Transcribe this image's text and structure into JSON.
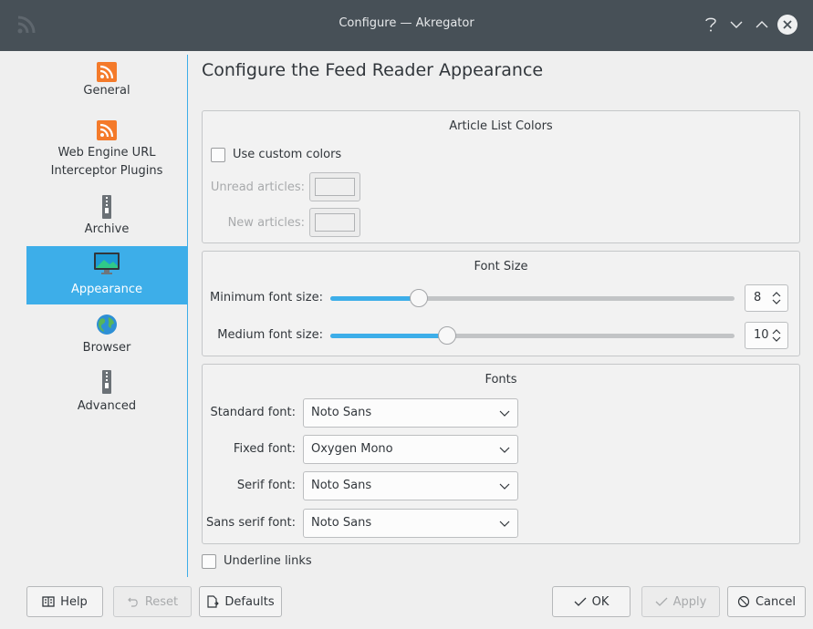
{
  "window": {
    "title": "Configure — Akregator"
  },
  "sidebar": {
    "items": [
      {
        "label": "General",
        "icon": "rss-feed-icon"
      },
      {
        "label": "Web Engine URL",
        "label2": "Interceptor Plugins",
        "icon": "rss-feed-icon"
      },
      {
        "label": "Archive",
        "icon": "archive-zipper-icon"
      },
      {
        "label": "Appearance",
        "icon": "monitor-icon",
        "selected": true
      },
      {
        "label": "Browser",
        "icon": "globe-icon"
      },
      {
        "label": "Advanced",
        "icon": "archive-zipper-icon"
      }
    ]
  },
  "page": {
    "title": "Configure the Feed Reader Appearance",
    "article_colors": {
      "title": "Article List Colors",
      "use_custom_label": "Use custom colors",
      "use_custom_checked": false,
      "unread_label": "Unread articles:",
      "new_label": "New articles:"
    },
    "font_size": {
      "title": "Font Size",
      "minimum_label": "Minimum font size:",
      "minimum_value": "8",
      "minimum_fraction": 0.22,
      "medium_label": "Medium font size:",
      "medium_value": "10",
      "medium_fraction": 0.29
    },
    "fonts": {
      "title": "Fonts",
      "standard_label": "Standard font:",
      "standard_value": "Noto Sans",
      "fixed_label": "Fixed font:",
      "fixed_value": "Oxygen Mono",
      "serif_label": "Serif font:",
      "serif_value": "Noto Sans",
      "sans_label": "Sans serif font:",
      "sans_value": "Noto Sans"
    },
    "underline_label": "Underline links",
    "underline_checked": false
  },
  "buttons": {
    "help": "Help",
    "reset": "Reset",
    "defaults": "Defaults",
    "ok": "OK",
    "apply": "Apply",
    "cancel": "Cancel"
  },
  "colors": {
    "accent": "#3daee9",
    "titlebar": "#475057",
    "rss_orange": "#f47a2a"
  }
}
